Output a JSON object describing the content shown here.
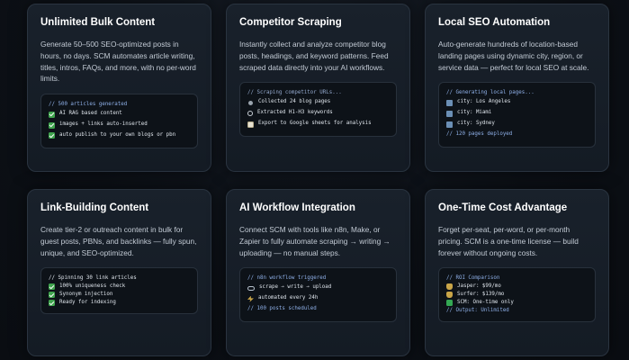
{
  "cards": [
    {
      "title": "Unlimited Bulk Content",
      "desc": "Generate 50–500 SEO-optimized posts in hours, no days. SCM automates article writing, titles, intros, FAQs, and more, with no per-word limits.",
      "terminal": [
        {
          "icon": "",
          "text": "// 500 articles generated"
        },
        {
          "icon": "check-icon",
          "text": "AI RAG based content"
        },
        {
          "icon": "check-icon",
          "text": "images + links auto-inserted"
        },
        {
          "icon": "check-icon",
          "text": "auto publish to your own blogs or pbn"
        }
      ]
    },
    {
      "title": "Competitor Scraping",
      "desc": "Instantly collect and analyze competitor blog posts, headings, and keyword patterns. Feed scraped data directly into your AI workflows.",
      "terminal": [
        {
          "icon": "",
          "text": "// Scraping competitor URLs..."
        },
        {
          "icon": "dot-icon",
          "text": "Collected 24 blog pages"
        },
        {
          "icon": "search-icon",
          "text": "Extracted H1-H3 keywords"
        },
        {
          "icon": "sheet-icon",
          "text": "Export to Google sheets for analysis"
        }
      ]
    },
    {
      "title": "Local SEO Automation",
      "desc": "Auto-generate hundreds of location-based landing pages using dynamic city, region, or service data — perfect for local SEO at scale.",
      "terminal": [
        {
          "icon": "",
          "text": "// Generating local pages..."
        },
        {
          "icon": "city-icon",
          "text": "city: Los Angeles"
        },
        {
          "icon": "city-icon",
          "text": "city: Miami"
        },
        {
          "icon": "city-icon",
          "text": "city: Sydney"
        },
        {
          "icon": "",
          "text": "// 120 pages deployed"
        }
      ]
    },
    {
      "title": "Link-Building Content",
      "desc": "Create tier-2 or outreach content in bulk for guest posts, PBNs, and backlinks — fully spun, unique, and SEO-optimized.",
      "terminal": [
        {
          "icon": "",
          "text": "// Spinning 30 link articles"
        },
        {
          "icon": "check-icon",
          "text": "100% uniqueness check"
        },
        {
          "icon": "check-icon",
          "text": "Synonym injection"
        },
        {
          "icon": "check-icon",
          "text": "Ready for indexing"
        }
      ]
    },
    {
      "title": "AI Workflow Integration",
      "desc": "Connect SCM with tools like n8n, Make, or Zapier to fully automate scraping → writing → uploading — no manual steps.",
      "terminal": [
        {
          "icon": "",
          "text": "// n8n workflow triggered"
        },
        {
          "icon": "chain-icon",
          "text": "scrape → write → upload"
        },
        {
          "icon": "bolt-icon",
          "text": "automated every 24h"
        },
        {
          "icon": "",
          "text": "// 100 posts scheduled"
        }
      ]
    },
    {
      "title": "One-Time Cost Advantage",
      "desc": "Forget per-seat, per-word, or per-month pricing. SCM is a one-time license — build forever without ongoing costs.",
      "terminal": [
        {
          "icon": "",
          "text": "// ROI Comparison"
        },
        {
          "icon": "bag-icon",
          "text": "Jasper: $99/mo"
        },
        {
          "icon": "bag-icon",
          "text": "Surfer: $139/mo"
        },
        {
          "icon": "square-icon",
          "text": "SCM: One-time only"
        },
        {
          "icon": "",
          "text": "// Output: Unlimited"
        }
      ]
    }
  ]
}
